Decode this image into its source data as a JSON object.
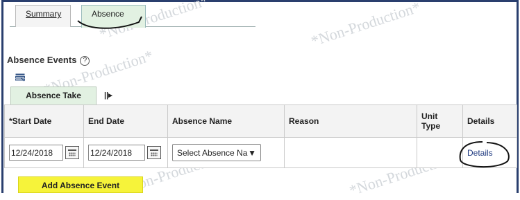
{
  "tabs": [
    {
      "label": "Summary"
    },
    {
      "label": "Absence"
    }
  ],
  "watermark": "*Non-Production*",
  "section": {
    "title": "Absence Events",
    "help_glyph": "?"
  },
  "subtab": {
    "label": "Absence Take"
  },
  "table": {
    "headers": [
      "*Start Date",
      "End Date",
      "Absence Name",
      "Reason",
      "Unit Type",
      "Details"
    ],
    "row": {
      "start_date": "12/24/2018",
      "end_date": "12/24/2018",
      "absence_name": "Select Absence Na",
      "reason": "",
      "unit_type": "",
      "details_link": "Details"
    }
  },
  "add_button": {
    "label": "Add Absence Event"
  },
  "colors": {
    "frame": "#2a3f6e",
    "active_tab": "#e2f1e2",
    "highlight": "#f6f33a",
    "link": "#1f3a80"
  },
  "icons": [
    "grid-view-icon",
    "expand-columns-icon",
    "calendar-icon",
    "dropdown-arrow-icon",
    "help-icon"
  ]
}
